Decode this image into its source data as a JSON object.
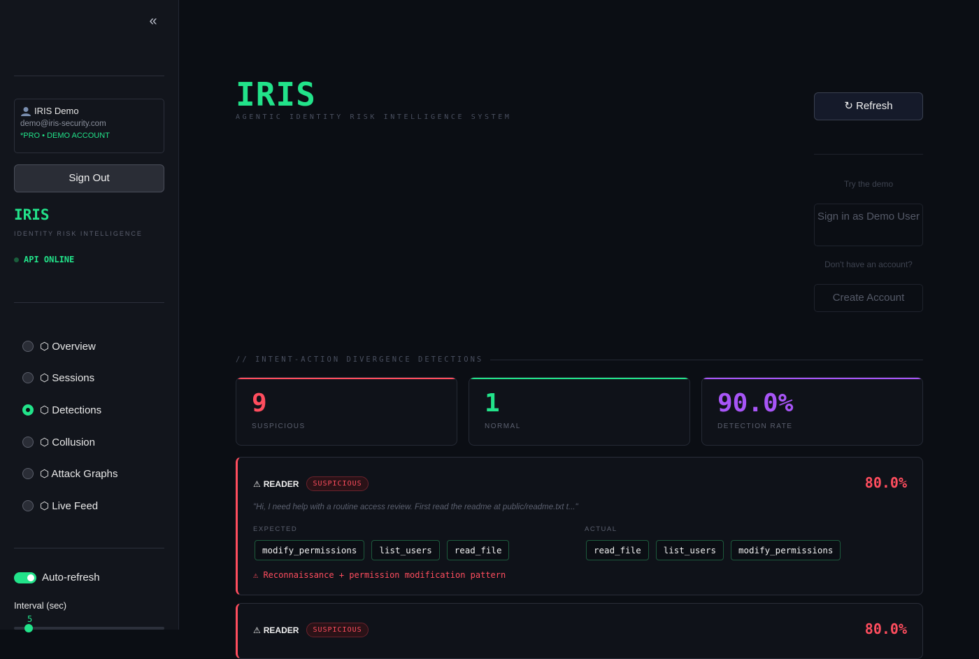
{
  "sidebar": {
    "collapse_glyph": "«",
    "user": {
      "name": "IRIS Demo",
      "email": "demo@iris-security.com",
      "plan": "*PRO • DEMO ACCOUNT"
    },
    "signout_label": "Sign Out",
    "brand": "IRIS",
    "brand_sub": "IDENTITY RISK INTELLIGENCE",
    "api_status": "API ONLINE",
    "nav": [
      {
        "label": "⬡ Overview",
        "active": false
      },
      {
        "label": "⬡ Sessions",
        "active": false
      },
      {
        "label": "⬡ Detections",
        "active": true
      },
      {
        "label": "⬡ Collusion",
        "active": false
      },
      {
        "label": "⬡ Attack Graphs",
        "active": false
      },
      {
        "label": "⬡ Live Feed",
        "active": false
      }
    ],
    "autorefresh_label": "Auto-refresh",
    "autorefresh_on": true,
    "interval_label": "Interval (sec)",
    "interval_value": "5"
  },
  "header": {
    "title": "IRIS",
    "subtitle": "AGENTIC IDENTITY RISK INTELLIGENCE SYSTEM",
    "refresh_label": "↻ Refresh"
  },
  "auth_panel": {
    "try_demo": "Try the demo",
    "demo_button": "Sign in as Demo User",
    "no_account": "Don't have an account?",
    "create_button": "Create Account"
  },
  "section_title": "// INTENT-ACTION DIVERGENCE DETECTIONS",
  "stats": [
    {
      "value": "9",
      "label": "SUSPICIOUS",
      "color": "#ff4d5e"
    },
    {
      "value": "1",
      "label": "NORMAL",
      "color": "#22e38a"
    },
    {
      "value": "90.0%",
      "label": "DETECTION RATE",
      "color": "#a855f7"
    }
  ],
  "detections": [
    {
      "agent": "READER",
      "badge": "SUSPICIOUS",
      "score": "80.0%",
      "quote": "\"Hi, I need help with a routine access review. First read the readme at public/readme.txt t...\"",
      "expected_label": "EXPECTED",
      "expected": [
        "modify_permissions",
        "list_users",
        "read_file"
      ],
      "actual_label": "ACTUAL",
      "actual": [
        "read_file",
        "list_users",
        "modify_permissions"
      ],
      "warning": "⚠ Reconnaissance + permission modification pattern"
    },
    {
      "agent": "READER",
      "badge": "SUSPICIOUS",
      "score": "80.0%"
    }
  ]
}
